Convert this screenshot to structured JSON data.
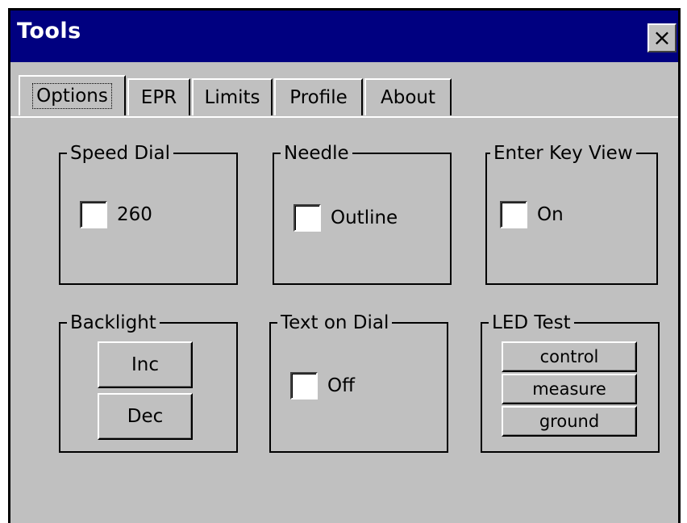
{
  "window": {
    "title": "Tools",
    "close_label": "×"
  },
  "tabs": [
    {
      "label": "Options",
      "active": true
    },
    {
      "label": "EPR"
    },
    {
      "label": "Limits"
    },
    {
      "label": "Profile"
    },
    {
      "label": "About"
    }
  ],
  "groups": {
    "speed_dial": {
      "label": "Speed Dial",
      "checkbox_label": "260",
      "checked": false
    },
    "needle": {
      "label": "Needle",
      "checkbox_label": "Outline",
      "checked": false
    },
    "enter_key_view": {
      "label": "Enter Key View",
      "checkbox_label": "On",
      "checked": false
    },
    "backlight": {
      "label": "Backlight",
      "inc_label": "Inc",
      "dec_label": "Dec"
    },
    "text_on_dial": {
      "label": "Text on Dial",
      "checkbox_label": "Off",
      "checked": false
    },
    "led_test": {
      "label": "LED Test",
      "control_label": "control",
      "measure_label": "measure",
      "ground_label": "ground"
    }
  },
  "colors": {
    "titlebar": "#000080",
    "face": "#c0c0c0"
  }
}
